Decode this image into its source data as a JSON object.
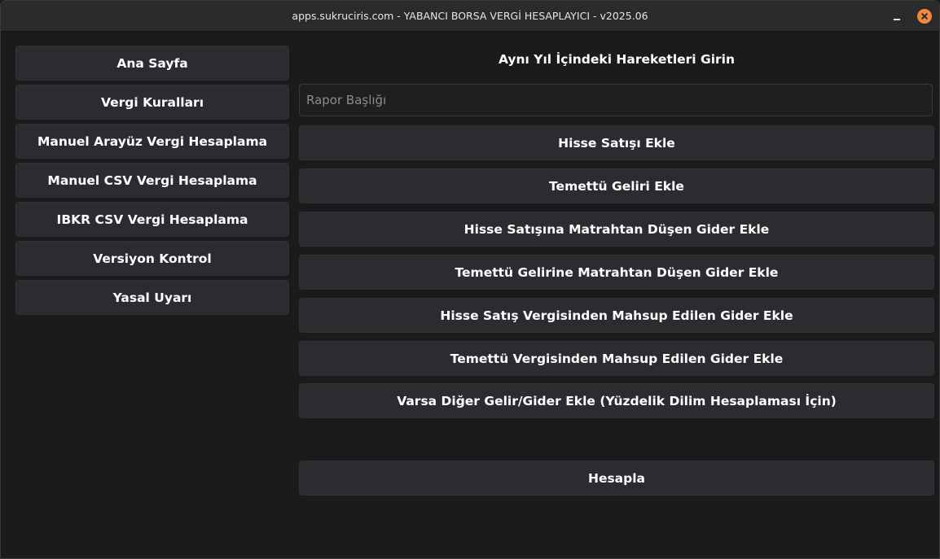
{
  "window": {
    "title": "apps.sukruciris.com - YABANCI BORSA VERGİ HESAPLAYICI - v2025.06"
  },
  "sidebar": {
    "items": [
      {
        "label": "Ana Sayfa"
      },
      {
        "label": "Vergi Kuralları"
      },
      {
        "label": "Manuel Arayüz Vergi Hesaplama"
      },
      {
        "label": "Manuel CSV Vergi Hesaplama"
      },
      {
        "label": "IBKR CSV Vergi Hesaplama"
      },
      {
        "label": "Versiyon Kontrol"
      },
      {
        "label": "Yasal Uyarı"
      }
    ]
  },
  "main": {
    "heading": "Aynı Yıl İçindeki Hareketleri Girin",
    "report_title_placeholder": "Rapor Başlığı",
    "report_title_value": "",
    "actions": [
      {
        "label": "Hisse Satışı Ekle"
      },
      {
        "label": "Temettü Geliri Ekle"
      },
      {
        "label": "Hisse Satışına Matrahtan Düşen Gider Ekle"
      },
      {
        "label": "Temettü Gelirine Matrahtan Düşen Gider Ekle"
      },
      {
        "label": "Hisse Satış Vergisinden Mahsup Edilen Gider Ekle"
      },
      {
        "label": "Temettü Vergisinden Mahsup Edilen Gider Ekle"
      },
      {
        "label": "Varsa Diğer Gelir/Gider Ekle (Yüzdelik Dilim Hesaplaması İçin)"
      }
    ],
    "calculate_label": "Hesapla"
  },
  "colors": {
    "background": "#1b1b1b",
    "titlebar": "#2b2b2b",
    "button": "#2c2c30",
    "close_accent": "#f0883e"
  }
}
